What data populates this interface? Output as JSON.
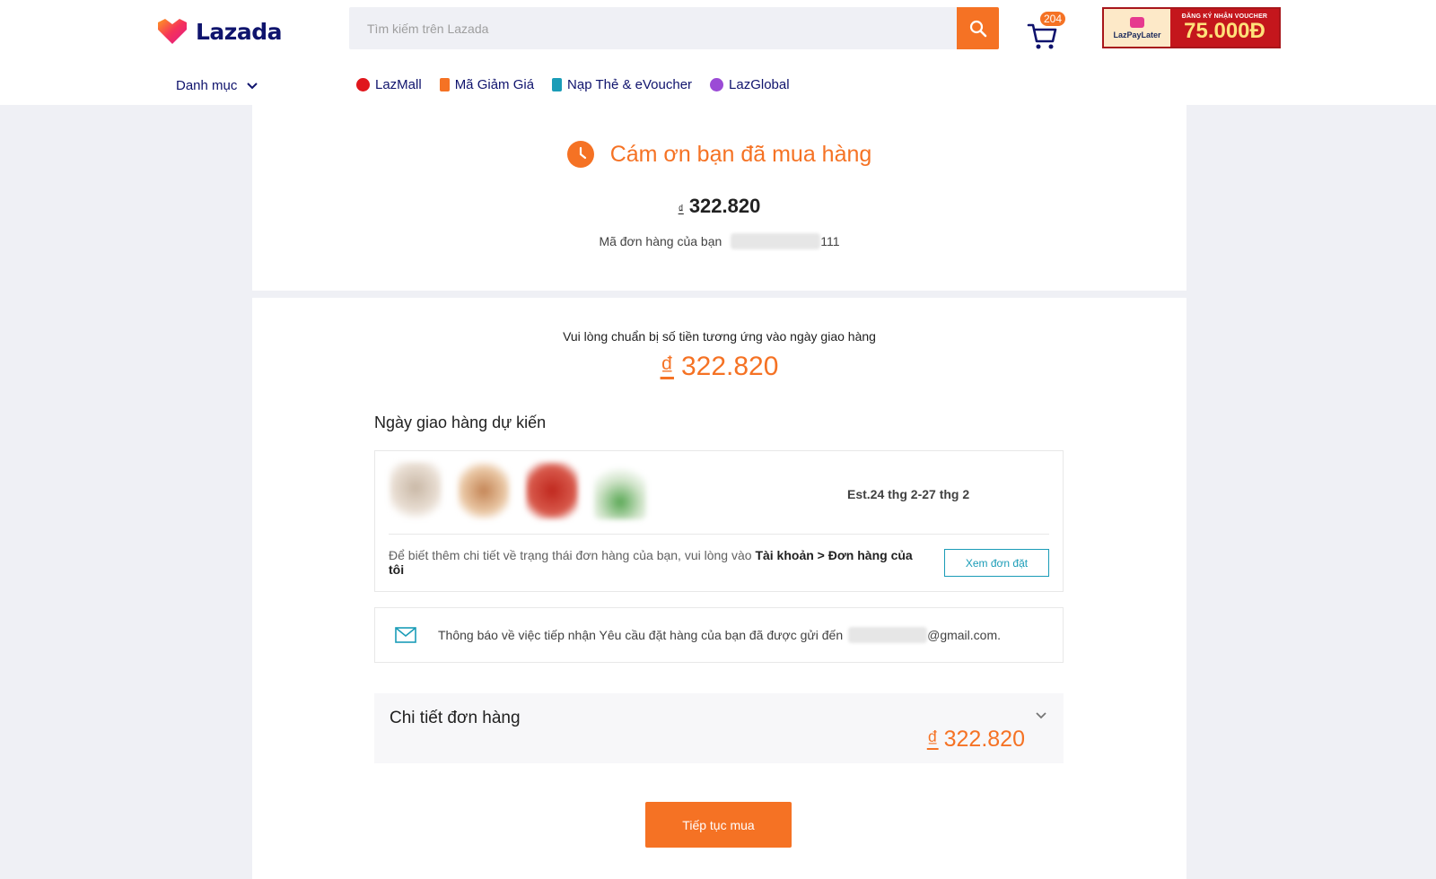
{
  "header": {
    "logo_text": "Lazada",
    "search_placeholder": "Tìm kiếm trên Lazada",
    "cart_count": "204",
    "promo": {
      "brand": "LazPayLater",
      "subtitle": "ĐĂNG KÝ NHẬN VOUCHER",
      "amount": "75.000Đ"
    }
  },
  "nav": {
    "category_label": "Danh mục",
    "links": [
      {
        "label": "LazMall",
        "icon": "lazmall-icon",
        "color": "#e0161c"
      },
      {
        "label": "Mã Giảm Giá",
        "icon": "voucher-icon",
        "color": "#f57224"
      },
      {
        "label": "Nạp Thẻ & eVoucher",
        "icon": "phone-topup-icon",
        "color": "#1a9cb7"
      },
      {
        "label": "LazGlobal",
        "icon": "global-icon",
        "color": "#9b4bd6"
      }
    ]
  },
  "summary": {
    "thanks": "Cám ơn bạn đã mua hàng",
    "currency": "₫",
    "amount": "322.820",
    "order_label": "Mã đơn hàng của bạn",
    "order_suffix": "111"
  },
  "payment": {
    "prepare_text": "Vui lòng chuẩn bị số tiền tương ứng vào ngày giao hàng",
    "currency": "₫",
    "amount": "322.820"
  },
  "delivery": {
    "title": "Ngày giao hàng dự kiến",
    "estimate": "Est.24 thg 2-27 thg 2",
    "info_prefix": "Để biết thêm chi tiết về trạng thái đơn hàng của bạn, vui lòng vào ",
    "info_bold": "Tài khoản > Đơn hàng của tôi",
    "view_button": "Xem đơn đặt"
  },
  "email": {
    "text": "Thông báo về việc tiếp nhận Yêu cầu đặt hàng của bạn đã được gửi đến",
    "domain": "@gmail.com."
  },
  "order_detail": {
    "title": "Chi tiết đơn hàng",
    "currency": "₫",
    "amount": "322.820"
  },
  "continue_button": "Tiếp tục mua",
  "colors": {
    "accent": "#f57224",
    "link_blue": "#1a9cb7",
    "nav_text": "#0f136d"
  }
}
